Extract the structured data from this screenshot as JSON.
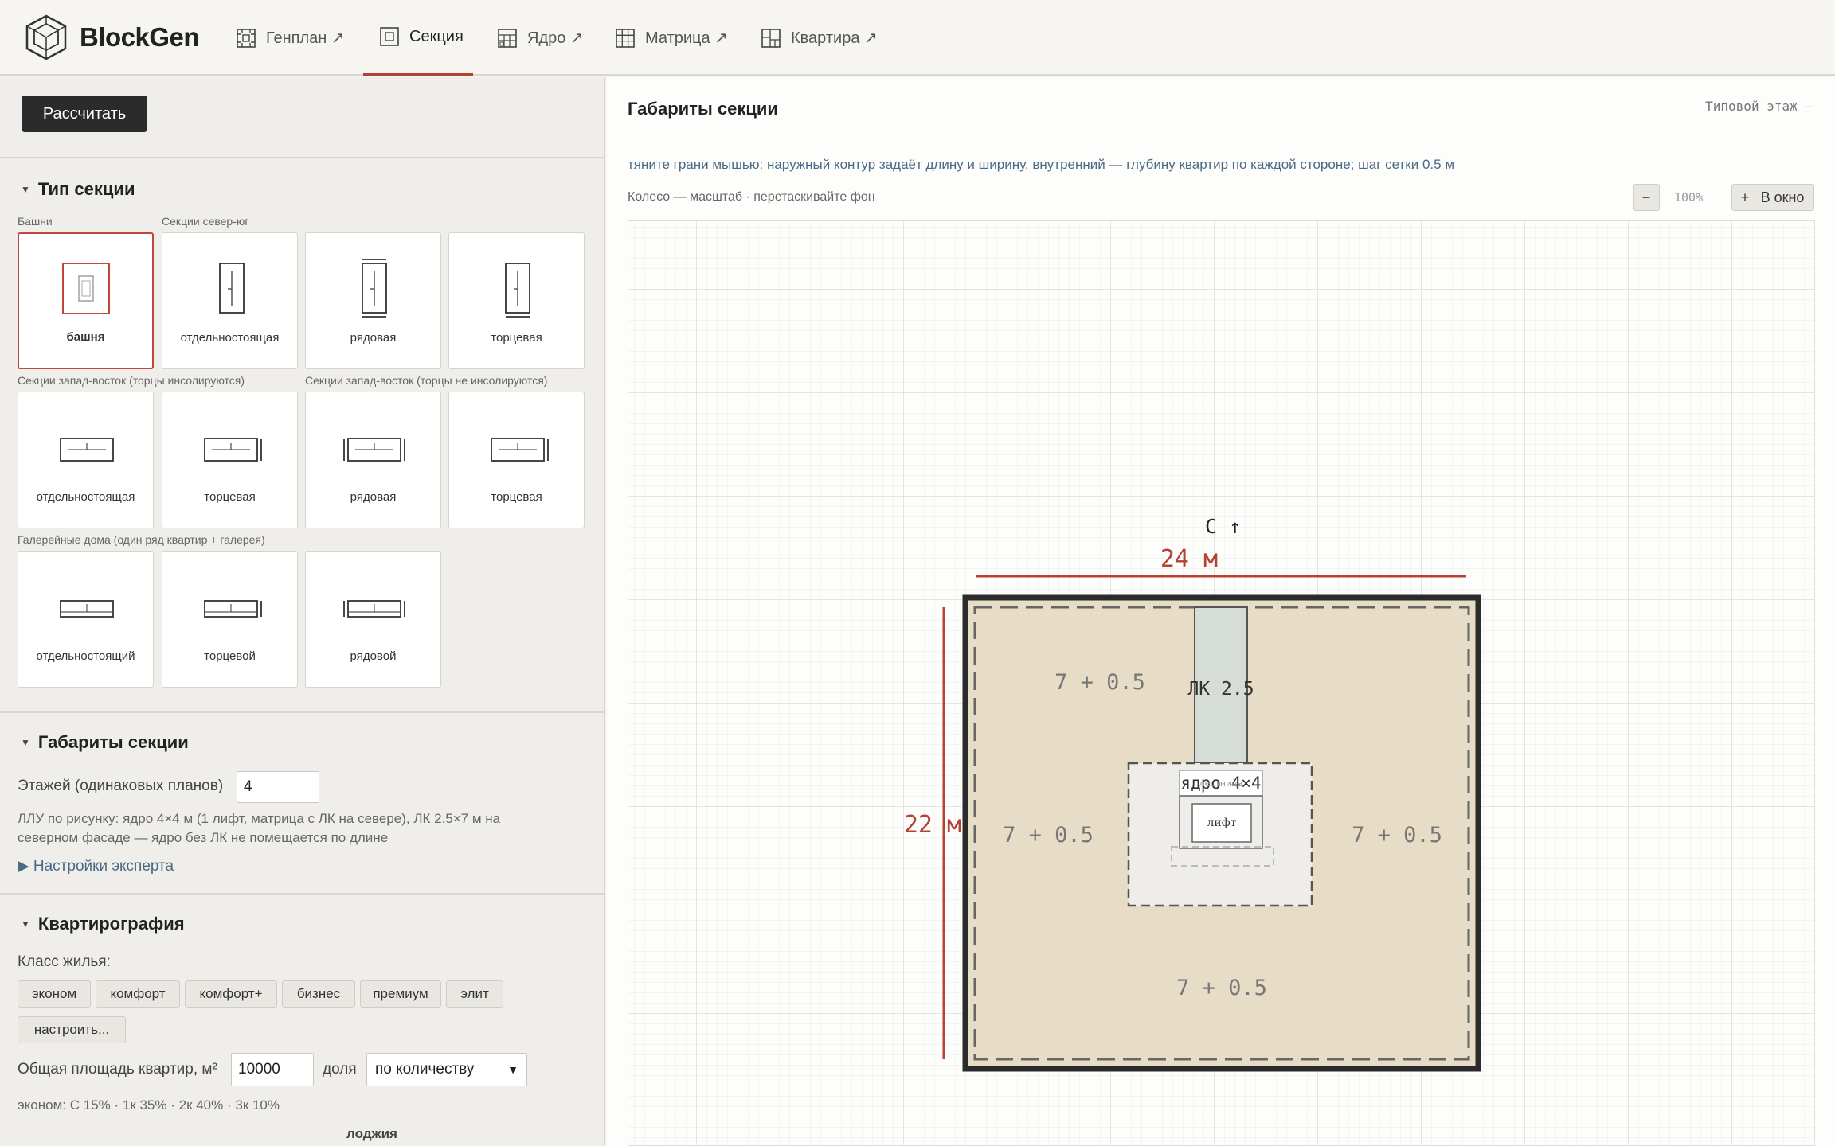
{
  "app": {
    "name": "BlockGen"
  },
  "nav": [
    {
      "label": "Генплан ↗",
      "icon": "site-plan-icon"
    },
    {
      "label": "Секция",
      "icon": "section-icon"
    },
    {
      "label": "Ядро ↗",
      "icon": "core-icon"
    },
    {
      "label": "Матрица ↗",
      "icon": "matrix-icon"
    },
    {
      "label": "Квартира ↗",
      "icon": "apartment-icon"
    }
  ],
  "sidebar": {
    "calculate_label": "Рассчитать",
    "section_type": {
      "title": "Тип секции",
      "groups": [
        {
          "label": "Башни"
        },
        {
          "label": "Секции север-юг"
        },
        {
          "label": "Секции запад-восток (торцы инсолируются)"
        },
        {
          "label": "Секции запад-восток (торцы не инсолируются)"
        },
        {
          "label": "Галерейные дома (один ряд квартир + галерея)"
        }
      ],
      "cards": [
        {
          "label": "башня",
          "selected": true
        },
        {
          "label": "отдельностоящая"
        },
        {
          "label": "рядовая"
        },
        {
          "label": "торцевая"
        },
        {
          "label": "отдельностоящая"
        },
        {
          "label": "торцевая"
        },
        {
          "label": "рядовая"
        },
        {
          "label": "торцевая"
        },
        {
          "label": "отдельностоящий"
        },
        {
          "label": "торцевой"
        },
        {
          "label": "рядовой"
        }
      ]
    },
    "dimensions": {
      "title": "Габариты секции",
      "floors_label": "Этажей (одинаковых планов)",
      "floors_value": "4",
      "help": "ЛЛУ по рисунку: ядро 4×4 м (1 лифт, матрица с ЛК на севере), ЛК 2.5×7 м на северном фасаде — ядро без ЛК не помещается по длине",
      "expert_label": "▶ Настройки эксперта"
    },
    "apartments": {
      "title": "Квартирография",
      "class_label": "Класс жилья:",
      "classes": [
        "эконом",
        "комфорт",
        "комфорт+",
        "бизнес",
        "премиум",
        "элит"
      ],
      "configure_label": "настроить...",
      "area_label": "Общая площадь квартир, м²",
      "area_value": "10000",
      "share_label": "доля",
      "share_select": "по количеству",
      "mix_text": "эконом: С 15% · 1к 35% · 2к 40% · 3к 10%",
      "loggia_label": "лоджия"
    }
  },
  "main": {
    "title": "Габариты секции",
    "floor_label": "Типовой этаж  —",
    "hint": "тяните грани мышью: наружный контур задаёт длину и ширину, внутренний — глубину квартир по каждой стороне; шаг сетки 0.5 м",
    "hint2": "Колесо — масштаб · перетаскивайте фон",
    "zoom": {
      "minus": "−",
      "value": "100%",
      "plus": "+",
      "fit": "В окно"
    }
  },
  "plan": {
    "north_label": "С  ↑",
    "width_label": "24 м",
    "height_label": "22 м",
    "depth_north": "7 + 0.5",
    "depth_west": "7 + 0.5",
    "depth_east": "7 + 0.5",
    "depth_south": "7 + 0.5",
    "lk_label": "ЛК 2.5",
    "core_label": "ядро 4×4",
    "stair_label": "лестница",
    "lift_label": "лифт",
    "colors": {
      "accent": "#b64234",
      "floor": "#e7dcc6",
      "lk": "#d5ddd6"
    }
  }
}
